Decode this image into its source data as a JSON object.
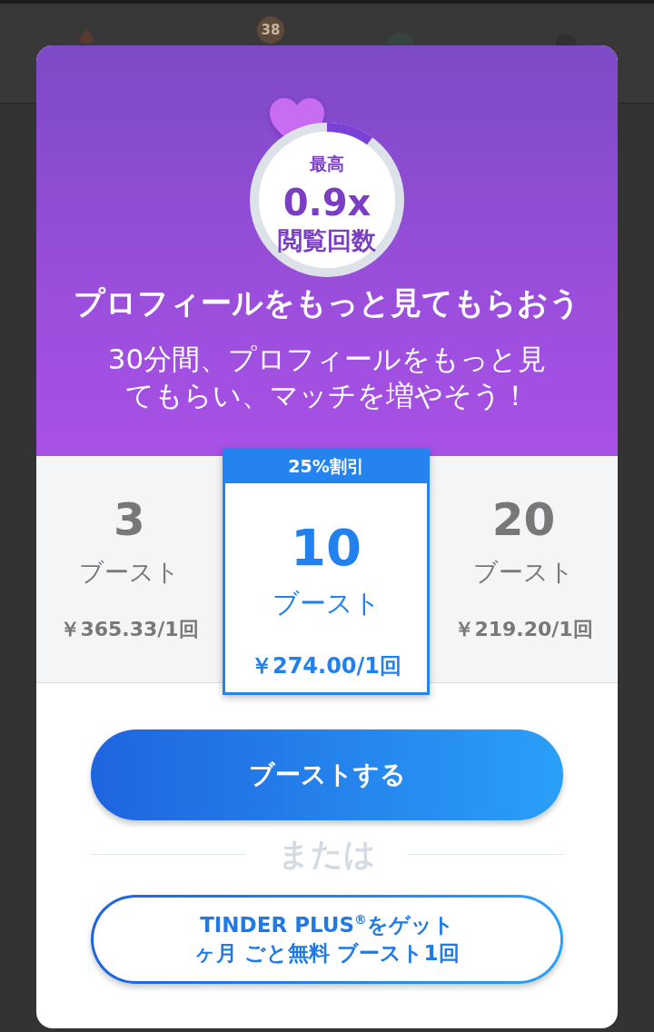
{
  "background": {
    "badge": "38"
  },
  "booster": {
    "label_top": "最高",
    "multiplier": "0.9x",
    "label_bottom": "閲覧回数",
    "level": 0.1
  },
  "title": "プロフィールをもっと見てもらおう",
  "subtitle": "30分間、プロフィールをもっと見てもらい、マッチを増やそう！",
  "plans": [
    {
      "count": "3",
      "unit": "ブースト",
      "price": "￥365.33/1回",
      "selected": false
    },
    {
      "badge": "25%割引",
      "count": "10",
      "unit": "ブースト",
      "price": "￥274.00/1回",
      "selected": true
    },
    {
      "count": "20",
      "unit": "ブースト",
      "price": "￥219.20/1回",
      "selected": false
    }
  ],
  "primary_button": "ブーストする",
  "separator": "または",
  "plus_button": {
    "lines": [
      "TINDER PLUS$^{®}$をゲット",
      "ヶ月 ごと無料 ブースト1回"
    ]
  }
}
